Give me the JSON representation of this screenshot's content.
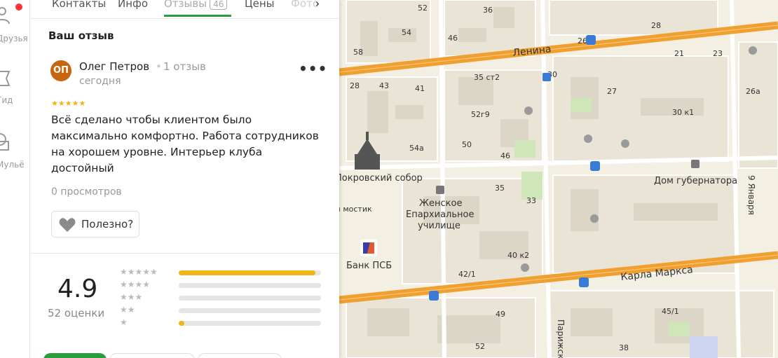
{
  "rail": {
    "items": [
      {
        "label": "Друзья"
      },
      {
        "label": "Гид"
      },
      {
        "label": "Мульё"
      }
    ]
  },
  "tabs": [
    {
      "label": "Контакты"
    },
    {
      "label": "Инфо"
    },
    {
      "label": "Отзывы",
      "count": "46"
    },
    {
      "label": "Цены"
    },
    {
      "label": "Фото"
    }
  ],
  "review": {
    "section_title": "Ваш отзыв",
    "avatar_initials": "ОП",
    "avatar_color": "#c8650f",
    "author": "Олег Петров",
    "author_reviews": "1 отзыв",
    "date": "сегодня",
    "stars": 5,
    "stars_text": "★★★★★",
    "text": "Всё сделано чтобы клиентом было максимально комфортно. Работа сотрудников на хорошем уровне. Интерьер клуба достойный",
    "views": "0 просмотров",
    "useful_label": "Полезно?"
  },
  "rating": {
    "value": "4.9",
    "count_label": "52 оценки",
    "rows": [
      {
        "stars": "★★★★★",
        "fraction": 0.96
      },
      {
        "stars": "★★★★",
        "fraction": 0.0
      },
      {
        "stars": "★★★",
        "fraction": 0.0
      },
      {
        "stars": "★★",
        "fraction": 0.0
      },
      {
        "stars": "★",
        "fraction": 0.04
      }
    ]
  },
  "map": {
    "streets": [
      "Ленина",
      "Карла Маркса",
      "9 Января",
      "Парижской"
    ],
    "poi": {
      "cathedral": "Покровский собор",
      "school": "Женское Епархиальное училище",
      "bank": "Банк ПСБ",
      "governor": "Дом губернатора",
      "bridge": "Каменный мостик"
    },
    "house_numbers": [
      "52",
      "36",
      "54",
      "46",
      "28",
      "58",
      "26",
      "21",
      "23",
      "30",
      "35 ст2",
      "43",
      "41",
      "27",
      "28",
      "26а",
      "52г9",
      "30 к1",
      "50",
      "54а",
      "46",
      "35",
      "33",
      "40 к2",
      "42/1",
      "49",
      "45/1",
      "52",
      "38"
    ]
  },
  "colors": {
    "accent": "#2a9d3f",
    "star": "#f2b417",
    "road": "#f0a030"
  }
}
